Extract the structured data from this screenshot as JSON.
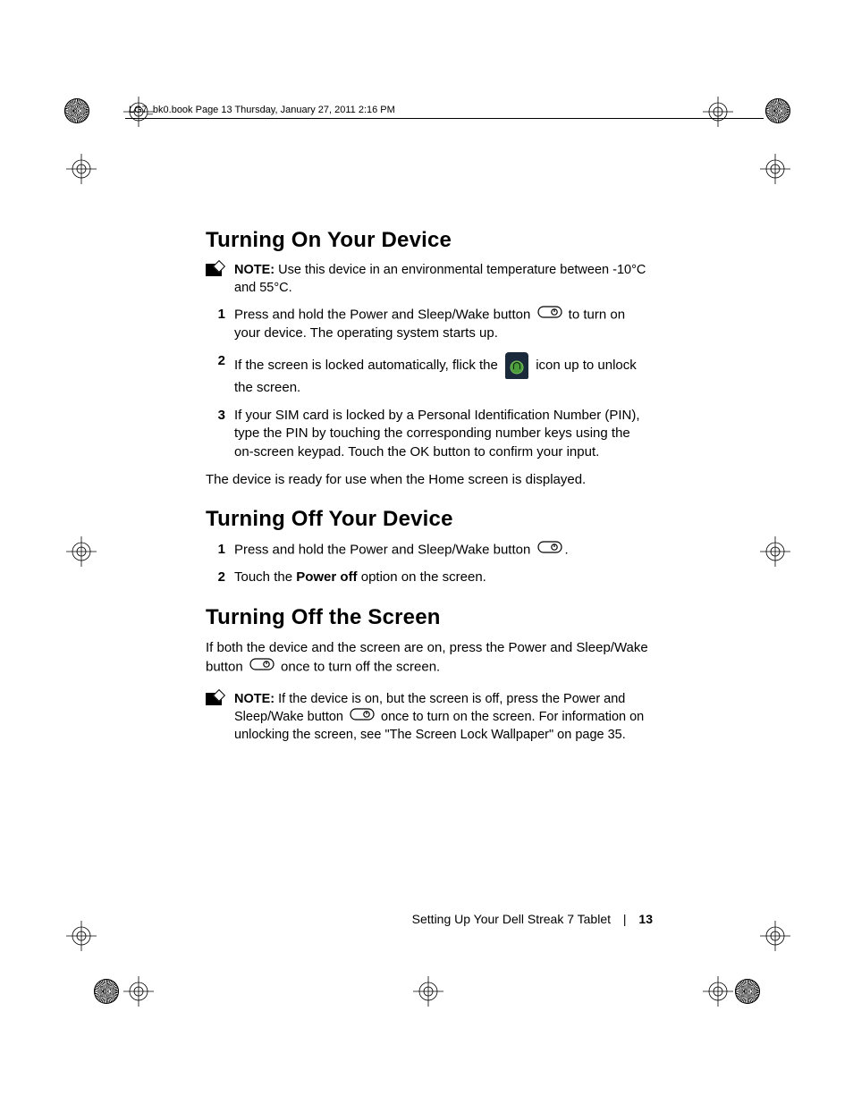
{
  "header_line": "LG7_bk0.book  Page 13  Thursday, January 27, 2011  2:16 PM",
  "sections": {
    "on": {
      "title": "Turning On Your Device",
      "note_label": "NOTE:",
      "note_text": " Use this device in an environmental temperature between -10°C and 55°C.",
      "step1_a": "Press and hold the Power and Sleep/Wake button ",
      "step1_b": " to turn on your device. The operating system starts up.",
      "step2_a": "If the screen is locked automatically, flick the ",
      "step2_b": " icon up to unlock the screen.",
      "step3": "If your SIM card is locked by a Personal Identification Number (PIN), type the PIN by touching the corresponding number keys using the on-screen keypad. Touch the OK button to confirm your input.",
      "ready": "The device is ready for use when the Home screen is displayed."
    },
    "off": {
      "title": "Turning Off Your Device",
      "step1": "Press and hold the Power and Sleep/Wake button ",
      "step1_end": ".",
      "step2_a": "Touch the ",
      "step2_bold": "Power off",
      "step2_b": " option on the screen."
    },
    "screen": {
      "title": "Turning Off the Screen",
      "para_a": "If both the device and the screen are on, press the Power and Sleep/Wake button ",
      "para_b": " once to turn off the screen.",
      "note_label": "NOTE:",
      "note_a": " If the device is on, but the screen is off, press the Power and Sleep/Wake button ",
      "note_b": " once to turn on the screen. For information on unlocking the screen, see \"The Screen Lock Wallpaper\" on page 35."
    }
  },
  "numbers": {
    "n1": "1",
    "n2": "2",
    "n3": "3"
  },
  "footer": {
    "chapter": "Setting Up Your Dell Streak 7 Tablet",
    "sep": "|",
    "page": "13"
  }
}
